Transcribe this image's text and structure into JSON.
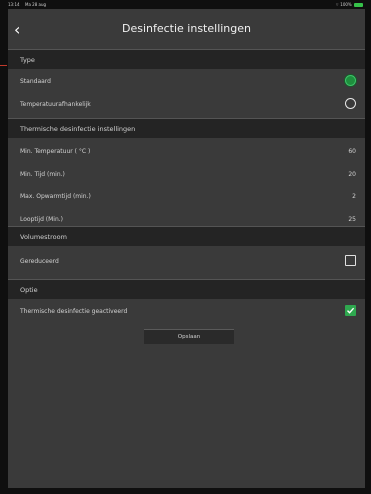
{
  "status": {
    "time": "13:14",
    "date": "Ma 28 aug",
    "right": "100%"
  },
  "header": {
    "title": "Desinfectie instellingen"
  },
  "sections": {
    "type": "Type",
    "thermal": "Thermische desinfectie instellingen",
    "flow": "Volumestroom",
    "option": "Optie"
  },
  "type_options": [
    {
      "label": "Standaard",
      "selected": true
    },
    {
      "label": "Temperatuurafhankelijk",
      "selected": false
    }
  ],
  "thermal_rows": [
    {
      "label": "Min. Temperatuur ( °C )",
      "value": "60"
    },
    {
      "label": "Min. Tijd (min.)",
      "value": "20"
    },
    {
      "label": "Max. Opwarmtijd (min.)",
      "value": "2"
    },
    {
      "label": "Looptijd (Min.)",
      "value": "25"
    }
  ],
  "flow_rows": [
    {
      "label": "Gereduceerd",
      "checked": false
    }
  ],
  "option_rows": [
    {
      "label": "Thermische desinfectie geactiveerd",
      "checked": true
    }
  ],
  "save_label": "Opslaan",
  "colors": {
    "background": "#3a3a3a",
    "section": "#242424",
    "accent_green": "#2fa84f"
  }
}
